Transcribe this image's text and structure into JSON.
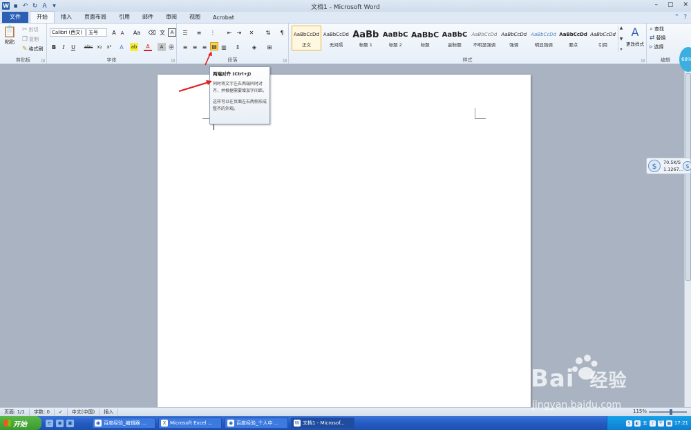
{
  "title_bar": {
    "title": "文档1 - Microsoft Word",
    "qat_icons": [
      "word-icon",
      "save-icon",
      "undo-icon",
      "redo-icon",
      "spelling-icon",
      "customize-icon"
    ]
  },
  "tabs": [
    "文件",
    "开始",
    "插入",
    "页面布局",
    "引用",
    "邮件",
    "审阅",
    "视图",
    "Acrobat"
  ],
  "clipboard": {
    "paste": "粘贴",
    "cut": "剪切",
    "copy": "复制",
    "format_painter": "格式刷",
    "label": "剪贴板"
  },
  "font": {
    "font_name": "Calibri (西文)",
    "font_size": "五号",
    "grow": "A",
    "shrink": "A",
    "change_case": "Aa",
    "bold": "B",
    "italic": "I",
    "underline": "U",
    "strike": "abc",
    "sub": "x₂",
    "sup": "x²",
    "text_effect": "A",
    "highlight": "ab",
    "color_a": "A",
    "char_shading": "A",
    "char_border": "A",
    "label": "字体"
  },
  "paragraph": {
    "label": "段落"
  },
  "styles": {
    "label": "样式",
    "items": [
      {
        "sample": "AaBbCcDd",
        "name": "正文"
      },
      {
        "sample": "AaBbCcDd",
        "name": "无间隔"
      },
      {
        "sample": "AaBb",
        "name": "标题 1"
      },
      {
        "sample": "AaBbC",
        "name": "标题 2"
      },
      {
        "sample": "AaBbC",
        "name": "标题"
      },
      {
        "sample": "AaBbC",
        "name": "副标题"
      },
      {
        "sample": "AaBbCcDd",
        "name": "不明显强调"
      },
      {
        "sample": "AaBbCcDd",
        "name": "强调"
      },
      {
        "sample": "AaBbCcDd",
        "name": "明显强调"
      },
      {
        "sample": "AaBbCcDd",
        "name": "要点"
      },
      {
        "sample": "AaBbCcDd",
        "name": "引用"
      }
    ],
    "change_styles": "更改样式"
  },
  "editing": {
    "find": "查找",
    "replace": "替换",
    "select": "选择",
    "label": "编辑"
  },
  "tooltip": {
    "title": "两端对齐 (Ctrl+J)",
    "body1": "同时将文字左右两端同时对齐，并根据需要增加字间距。",
    "body2": "这样可以在页面左右两侧形成整齐的外观。"
  },
  "net_widget": {
    "upload": "70.5K/S",
    "download": "1.1267..."
  },
  "pct_bubble": "68%",
  "status": {
    "page": "页面: 1/1",
    "words": "字数: 0",
    "language": "中文(中国)",
    "mode": "插入",
    "zoom": "115%"
  },
  "taskbar": {
    "start": "开始",
    "tasks": [
      {
        "label": "百度经验_编辑器 ..."
      },
      {
        "label": "Microsoft Excel ..."
      },
      {
        "label": "百度经验_个人中 ..."
      },
      {
        "label": "文档1 - Microsof..."
      }
    ],
    "clock": "17:21",
    "ime": "五"
  },
  "watermark": {
    "logo": "Bai",
    "logo_cn": "经验",
    "url": "jingyan.baidu.com"
  },
  "colors": {
    "file_tab": "#2b5fb4",
    "ribbon_bg": "#e6eef8",
    "workspace": "#a9b3c1",
    "annotation_arrow": "#e02020",
    "taskbar": "#245cc4",
    "tray": "#0f7fd0"
  }
}
